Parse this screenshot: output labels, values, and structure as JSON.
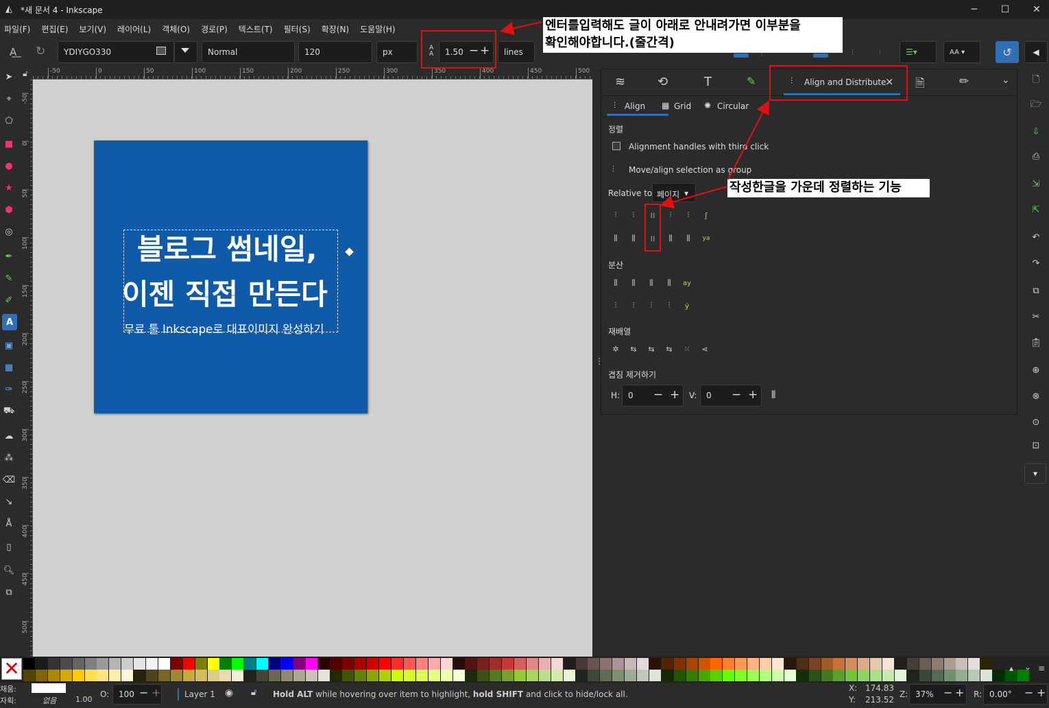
{
  "window": {
    "title": "*새 문서 4 - Inkscape",
    "minimize": "─",
    "maximize": "☐",
    "close": "✕"
  },
  "menu": [
    "파일(F)",
    "편집(E)",
    "보기(V)",
    "레이어(L)",
    "객체(O)",
    "경로(P)",
    "텍스트(T)",
    "필터(S)",
    "확장(N)",
    "도움말(H)"
  ],
  "text_toolbar": {
    "font_family": "YDIYGO330",
    "font_style": "Normal",
    "font_size": "120",
    "unit": "px",
    "line_height_label": "A\nA",
    "line_height": "1.50",
    "line_height_unit": "lines",
    "aa_label": "AA"
  },
  "ruler": {
    "h_ticks": [
      "-50",
      "0",
      "50",
      "100",
      "150",
      "200",
      "250",
      "300",
      "350",
      "400",
      "450",
      "500"
    ],
    "v_ticks": [
      "-50",
      "0",
      "50",
      "100",
      "150",
      "200",
      "250",
      "300",
      "350",
      "400",
      "450",
      "500"
    ]
  },
  "canvas_text": {
    "line1": "블로그 썸네일,",
    "line2": "이젠 직접 만든다",
    "line3": "무료 툴 Inkscape로 대표이미지 완성하기"
  },
  "dock": {
    "tabs": [
      "Align and Distribute"
    ],
    "close_tab": "×",
    "subtabs": [
      "Align",
      "Grid",
      "Circular"
    ],
    "align_heading": "정렬",
    "opt1": "Alignment handles with third click",
    "opt2": "Move/align selection as group",
    "relative_label": "Relative to:",
    "relative_value": "페이지",
    "distribute_heading": "분산",
    "rearrange_heading": "재배열",
    "overlap_heading": "겹침 제거하기",
    "h_label": "H:",
    "h_value": "0",
    "v_label": "V:",
    "v_value": "0"
  },
  "annotations": {
    "top_note_line1": "엔터를입력해도 글이 아래로 안내려가면 이부분을",
    "top_note_line2": "확인해야합니다.(줄간격)",
    "mid_note": "작성한글을 가운데 정렬하는 기능"
  },
  "status": {
    "fill_label": "채움:",
    "stroke_label": "자획:",
    "stroke_value": "없음",
    "stroke_width": "1.00",
    "opacity_label": "O:",
    "opacity_value": "100",
    "layer": "Layer 1",
    "msg_b1": "Hold ALT",
    "msg_t1": " while hovering over item to highlight, ",
    "msg_b2": "hold SHIFT",
    "msg_t2": " and click to hide/lock all.",
    "x_label": "X:",
    "x_value": "174.83",
    "y_label": "Y:",
    "y_value": "213.52",
    "z_label": "Z:",
    "zoom": "37%",
    "r_label": "R:",
    "rotation": "0.00°"
  },
  "colors": {
    "page": "#0f5aa9",
    "canvas_bg": "#d1d1d1",
    "annotation_red": "#e01010",
    "accent": "#2f6fb5"
  }
}
